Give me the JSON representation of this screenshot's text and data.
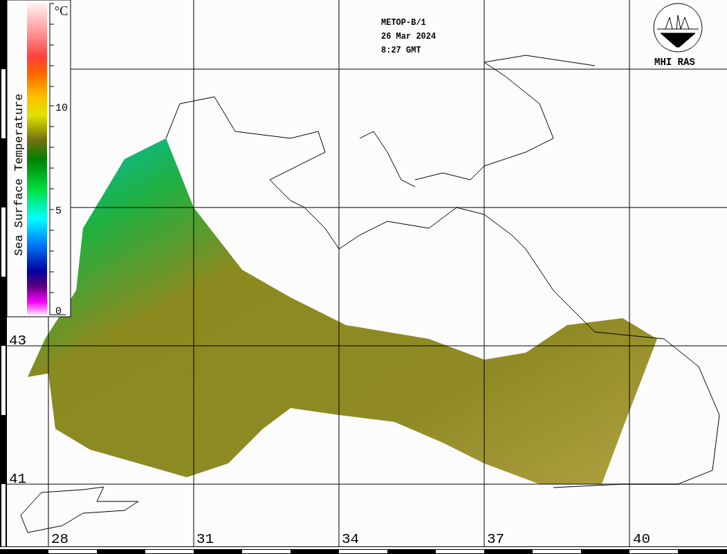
{
  "header": {
    "satellite": "METOP-B/1",
    "date": "26 Mar 2024",
    "time": "8:27 GMT"
  },
  "logo": {
    "text": "MHI RAS"
  },
  "legend": {
    "title": "Sea Surface Temperature",
    "unit": "°C",
    "ticks": [
      "10",
      "5",
      "0"
    ]
  },
  "latitude_labels": [
    "43",
    "41"
  ],
  "longitude_labels": [
    "28",
    "31",
    "34",
    "37",
    "40"
  ]
}
